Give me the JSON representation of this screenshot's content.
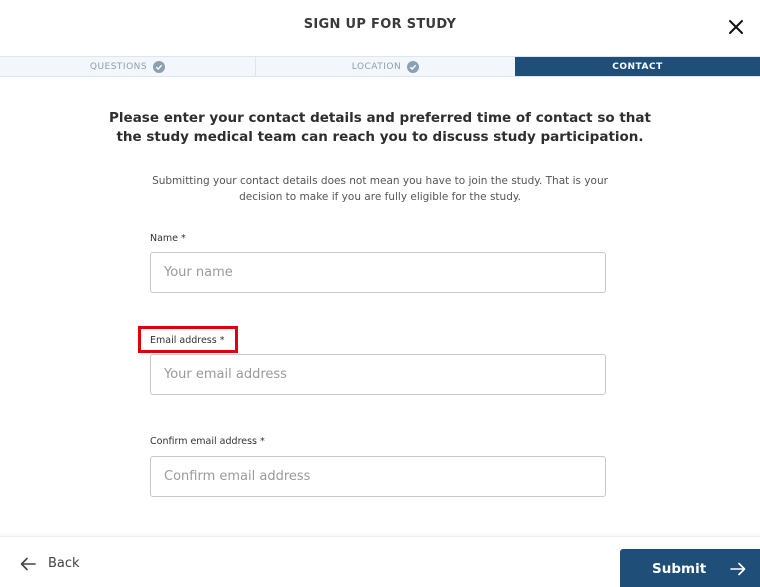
{
  "header": {
    "title": "SIGN UP FOR STUDY"
  },
  "steps": [
    {
      "label": "QUESTIONS",
      "complete": true
    },
    {
      "label": "LOCATION",
      "complete": true
    },
    {
      "label": "CONTACT",
      "active": true
    }
  ],
  "content": {
    "intro": "Please enter your contact details and preferred time of contact so that the study medical team can reach you to discuss study participation.",
    "note": "Submitting your contact details does not mean you have to join the study. That is your decision to make if you are fully eligible for the study."
  },
  "form": {
    "name": {
      "label": "Name *",
      "placeholder": "Your name",
      "value": ""
    },
    "email": {
      "label": "Email address *",
      "placeholder": "Your email address",
      "value": ""
    },
    "confirm_email": {
      "label": "Confirm email address *",
      "placeholder": "Confirm email address",
      "value": ""
    }
  },
  "footer": {
    "back_label": "Back",
    "submit_label": "Submit"
  },
  "colors": {
    "primary": "#1f4e79",
    "highlight": "#e0000b",
    "step_inactive_text": "#8aa0b3"
  }
}
